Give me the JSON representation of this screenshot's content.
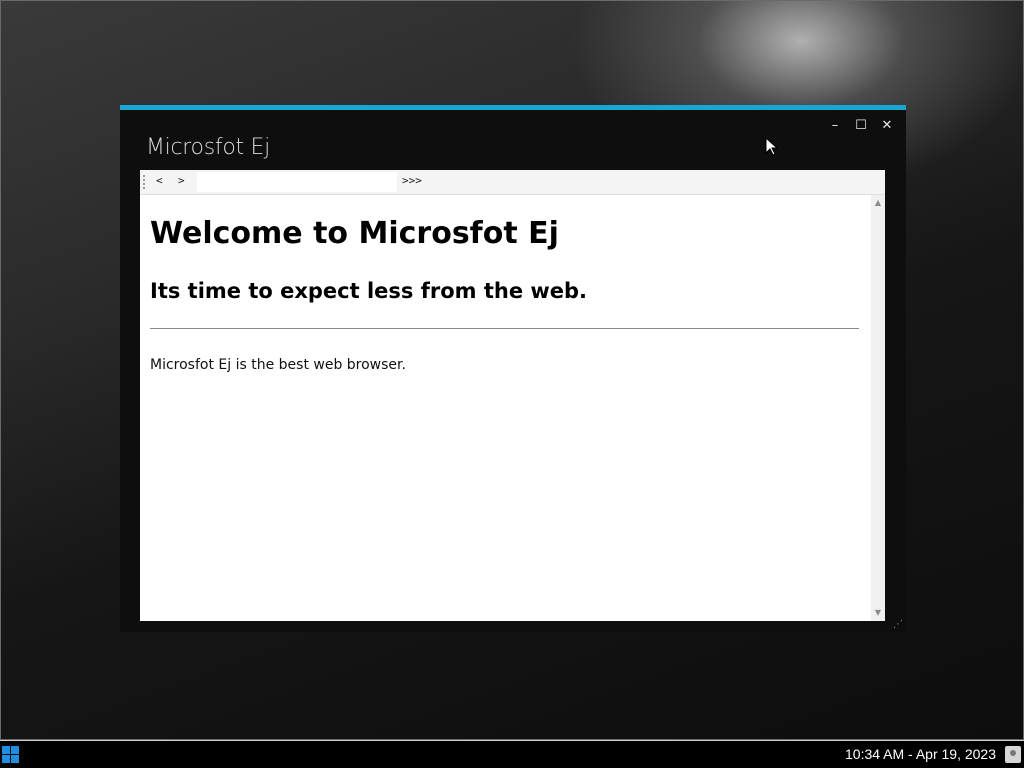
{
  "window": {
    "title": "Microsfot Ej",
    "accent_color": "#1aa6d2",
    "controls": {
      "minimize": "–",
      "maximize": "☐",
      "close": "✕"
    }
  },
  "toolbar": {
    "back_label": "<",
    "forward_label": ">",
    "address_value": "",
    "go_label": ">>>"
  },
  "page": {
    "heading": "Welcome to Microsfot Ej",
    "subheading": "Its time to expect less from the web.",
    "paragraph": "Microsfot Ej is the best web browser."
  },
  "scrollbar": {
    "up_arrow": "▲",
    "down_arrow": "▼"
  },
  "taskbar": {
    "start_icon": "windows-logo",
    "start_color": "#1e8fe0",
    "clock": "10:34 AM - Apr 19, 2023",
    "tray_icon": "user-icon"
  }
}
